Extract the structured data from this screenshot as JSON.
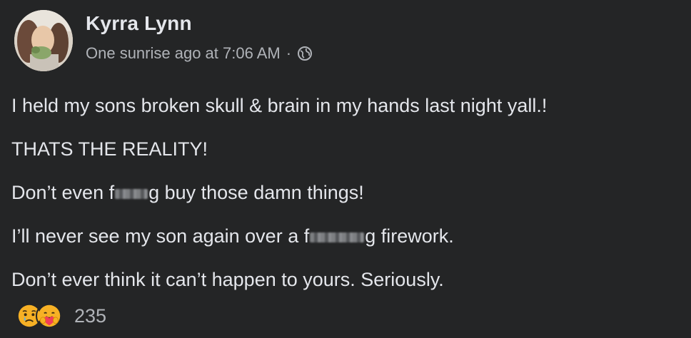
{
  "post": {
    "author": "Kyrra Lynn",
    "timestamp": "One sunrise ago at 7:06 AM",
    "separator": "·",
    "privacy_icon": "globe-icon",
    "lines": [
      {
        "before": "I held my sons broken skull & brain in my hands last night yall.!"
      },
      {
        "before": "THATS THE REALITY!"
      },
      {
        "before": "Don’t even f",
        "censored": true,
        "after": "g buy those damn things!"
      },
      {
        "before": "I’ll never see my son again over a f",
        "censored": true,
        "after": "g firework."
      },
      {
        "before": "Don’t ever think it can’t happen to yours. Seriously."
      }
    ],
    "reactions": {
      "icons": [
        "sad-reaction-icon",
        "care-reaction-icon"
      ],
      "count": "235"
    }
  },
  "colors": {
    "background": "#242526",
    "text_primary": "#e4e6eb",
    "text_secondary": "#b0b3b8",
    "sad_reaction": "#f7b125",
    "care_reaction": "#f7b125"
  }
}
